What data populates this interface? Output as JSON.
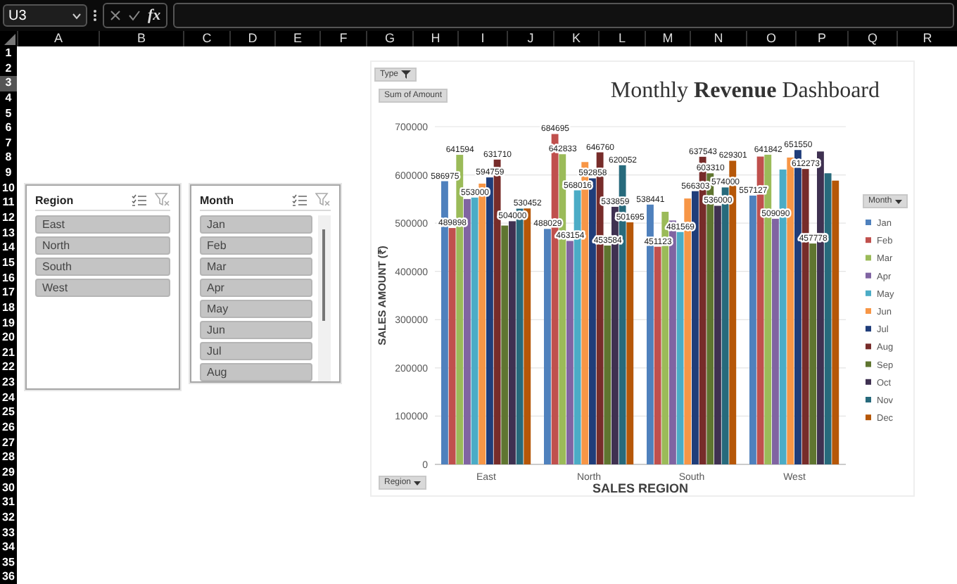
{
  "formula_bar": {
    "name_box": "U3",
    "fx": "fx"
  },
  "columns": [
    "A",
    "B",
    "C",
    "D",
    "E",
    "F",
    "G",
    "H",
    "I",
    "J",
    "K",
    "L",
    "M",
    "N",
    "O",
    "P",
    "Q",
    "R"
  ],
  "rows": [
    {
      "label": "1",
      "selected": false
    },
    {
      "label": "2",
      "selected": false
    },
    {
      "label": "3",
      "selected": true
    },
    {
      "label": "4",
      "selected": false
    },
    {
      "label": "5",
      "selected": false
    },
    {
      "label": "6",
      "selected": false
    },
    {
      "label": "7",
      "selected": false
    },
    {
      "label": "8",
      "selected": false
    },
    {
      "label": "9",
      "selected": false
    },
    {
      "label": "10",
      "selected": false
    },
    {
      "label": "11",
      "selected": false
    },
    {
      "label": "12",
      "selected": false
    },
    {
      "label": "13",
      "selected": false
    },
    {
      "label": "14",
      "selected": false
    },
    {
      "label": "15",
      "selected": false
    },
    {
      "label": "16",
      "selected": false
    },
    {
      "label": "17",
      "selected": false
    },
    {
      "label": "18",
      "selected": false
    },
    {
      "label": "19",
      "selected": false
    },
    {
      "label": "20",
      "selected": false
    },
    {
      "label": "21",
      "selected": false
    },
    {
      "label": "22",
      "selected": false
    },
    {
      "label": "23",
      "selected": false
    },
    {
      "label": "24",
      "selected": false
    },
    {
      "label": "25",
      "selected": false
    },
    {
      "label": "26",
      "selected": false
    },
    {
      "label": "27",
      "selected": false
    },
    {
      "label": "28",
      "selected": false
    },
    {
      "label": "29",
      "selected": false
    },
    {
      "label": "30",
      "selected": false
    },
    {
      "label": "31",
      "selected": false
    },
    {
      "label": "32",
      "selected": false
    },
    {
      "label": "33",
      "selected": false
    },
    {
      "label": "34",
      "selected": false
    },
    {
      "label": "35",
      "selected": false
    },
    {
      "label": "36",
      "selected": false
    }
  ],
  "slicers": [
    {
      "title": "Region",
      "scrollbar": false,
      "items": [
        {
          "label": "East",
          "selected": true
        },
        {
          "label": "North",
          "selected": true
        },
        {
          "label": "South",
          "selected": true
        },
        {
          "label": "West",
          "selected": true
        }
      ]
    },
    {
      "title": "Month",
      "scrollbar": true,
      "items": [
        {
          "label": "Jan",
          "selected": true
        },
        {
          "label": "Feb",
          "selected": true
        },
        {
          "label": "Mar",
          "selected": true
        },
        {
          "label": "Apr",
          "selected": true
        },
        {
          "label": "May",
          "selected": true
        },
        {
          "label": "Jun",
          "selected": true
        },
        {
          "label": "Jul",
          "selected": true
        },
        {
          "label": "Aug",
          "selected": true
        }
      ]
    }
  ],
  "pivot_chart": {
    "filter_button": "Type",
    "value_button": "Sum of Amount",
    "legend_button": "Month",
    "axis_button": "Region",
    "chart_data": {
      "type": "bar",
      "title": "Monthly **Revenue** Dashboard",
      "xlabel": "SALES REGION",
      "ylabel": "SALES AMOUNT (₹)",
      "categories": [
        "East",
        "North",
        "South",
        "West"
      ],
      "series": [
        {
          "name": "Jan",
          "color": "#4f81bd",
          "values": [
            586975,
            488029,
            538441,
            557127
          ],
          "value_labels": [
            "586975",
            "488029",
            "538441",
            "557127"
          ]
        },
        {
          "name": "Feb",
          "color": "#c0504d",
          "values": [
            489898,
            684695,
            451123,
            638000
          ],
          "value_labels": [
            "489898",
            "684695",
            "451123",
            null
          ]
        },
        {
          "name": "Mar",
          "color": "#9bbb59",
          "values": [
            641594,
            642833,
            523568,
            641842
          ],
          "value_labels": [
            "641594",
            "642833",
            null,
            "641842"
          ]
        },
        {
          "name": "Apr",
          "color": "#8064a2",
          "values": [
            550000,
            463154,
            505457,
            509090
          ],
          "value_labels": [
            null,
            "463154",
            null,
            "509090"
          ]
        },
        {
          "name": "May",
          "color": "#4bacc6",
          "values": [
            553000,
            568016,
            481569,
            611167
          ],
          "value_labels": [
            "553000",
            "568016",
            "481569",
            null
          ]
        },
        {
          "name": "Jun",
          "color": "#f79646",
          "values": [
            581927,
            626665,
            551107,
            635992
          ],
          "value_labels": [
            null,
            null,
            null,
            null
          ]
        },
        {
          "name": "Jul",
          "color": "#1f3d7a",
          "values": [
            594759,
            592858,
            566303,
            651550
          ],
          "value_labels": [
            "594759",
            "592858",
            "566303",
            "651550"
          ]
        },
        {
          "name": "Aug",
          "color": "#772c2a",
          "values": [
            631710,
            646760,
            637543,
            612273
          ],
          "value_labels": [
            "631710",
            "646760",
            "637543",
            "612273"
          ]
        },
        {
          "name": "Sep",
          "color": "#5f7530",
          "values": [
            495000,
            453584,
            603310,
            457778
          ],
          "value_labels": [
            null,
            "453584",
            "603310",
            "457778"
          ]
        },
        {
          "name": "Oct",
          "color": "#3f3151",
          "values": [
            504000,
            533859,
            536000,
            648536
          ],
          "value_labels": [
            "504000",
            "533859",
            "536000",
            null
          ]
        },
        {
          "name": "Nov",
          "color": "#276a7c",
          "values": [
            530000,
            620052,
            574000,
            603391
          ],
          "value_labels": [
            null,
            "620052",
            "574000",
            null
          ]
        },
        {
          "name": "Dec",
          "color": "#b65708",
          "values": [
            530452,
            501695,
            629301,
            588136
          ],
          "value_labels": [
            "530452",
            "501695",
            "629301",
            null
          ]
        }
      ],
      "ylim": [
        0,
        700000
      ],
      "yticks": [
        0,
        100000,
        200000,
        300000,
        400000,
        500000,
        600000,
        700000
      ],
      "grid": true,
      "legend": "right"
    }
  }
}
